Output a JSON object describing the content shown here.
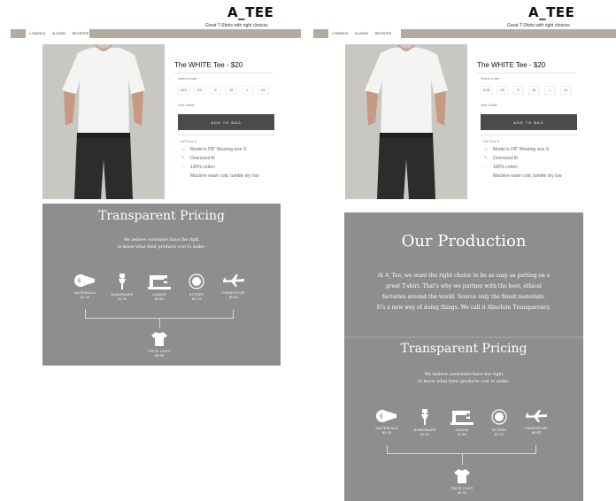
{
  "brand": {
    "name": "A_TEE",
    "tagline": "Great T-Shirts with right choices"
  },
  "nav": {
    "search": "SEARCH",
    "login": "LOGIN",
    "register": "REGISTER"
  },
  "product": {
    "name": "The WHITE Tee",
    "price": "$20",
    "title_full": "The WHITE Tee  - $20",
    "select_size_label": "Select a size",
    "sizes": [
      "XXS",
      "XS",
      "S",
      "M",
      "L",
      "XL"
    ],
    "size_guide": "Size Guide",
    "add_to_bag": "ADD TO BAG",
    "details_title": "DETAILS",
    "details": [
      {
        "icon": "person-icon",
        "text": "Model is 5'8\"   Wearing size S"
      },
      {
        "icon": "pencil-icon",
        "text": "Oversized fit"
      },
      {
        "icon": "fabric-icon",
        "text": "100% cotton"
      },
      {
        "icon": "",
        "text": "Machine wash cold, tumble dry low"
      }
    ]
  },
  "production": {
    "title": "Our Production",
    "lines": [
      "At A_Tee, we want the right choice to be as easy as putting on a",
      "great T-shirt.  That's why we partner with the best, ethical",
      "factories around the world.  Source only the finest materials.",
      "It's a new way of doing things.  We call it Absolute Transparency."
    ]
  },
  "pricing": {
    "title": "Transparent Pricing",
    "subtitle_lines": [
      "We believe customers have the right",
      "to know what their products cost to make:"
    ],
    "items": [
      {
        "label": "MATERIALS",
        "value": "$3.95",
        "icon": "thread-spool-icon"
      },
      {
        "label": "HARDWARE",
        "value": "$1.95",
        "icon": "zipper-icon"
      },
      {
        "label": "LABOR",
        "value": "$3.45",
        "icon": "sewing-machine-icon"
      },
      {
        "label": "DUTIES",
        "value": "$1.19",
        "icon": "duties-seal-icon"
      },
      {
        "label": "TRANSPORT",
        "value": "$0.41",
        "icon": "airplane-icon"
      }
    ],
    "true_cost_label": "TRUE COST",
    "true_cost_value": "$9.95",
    "true_cost_icon": "tshirt-icon"
  },
  "colors": {
    "nav_bar": "#b3ab9e",
    "grey_section": "#8e8e8e",
    "add_button": "#4b4b4b"
  }
}
